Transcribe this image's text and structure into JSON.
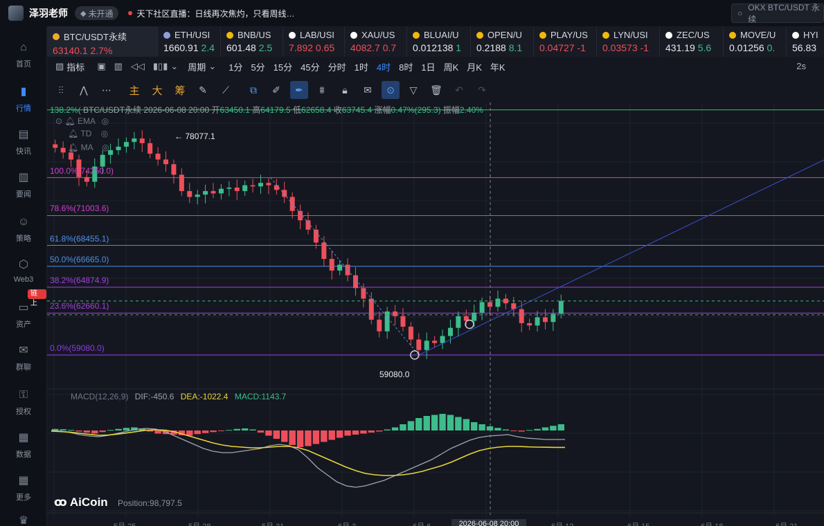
{
  "topbar": {
    "user_name": "泽羽老师",
    "member_status": "未开通",
    "live_text": "天下社区直播：日线再次焦灼，只看周线…",
    "search_placeholder": "OKX BTC/USDT 永续"
  },
  "sidebar": {
    "items": [
      {
        "label": "首页",
        "icon": "home-icon"
      },
      {
        "label": "行情",
        "icon": "market-icon",
        "active": true
      },
      {
        "label": "快讯",
        "icon": "news-icon"
      },
      {
        "label": "要闻",
        "icon": "headline-icon"
      },
      {
        "label": "策略",
        "icon": "robot-icon"
      },
      {
        "label": "Web3",
        "icon": "web3-icon"
      },
      {
        "label": "资产",
        "icon": "wallet-icon"
      },
      {
        "label": "群聊",
        "icon": "chat-icon"
      },
      {
        "label": "授权",
        "icon": "key-icon"
      },
      {
        "label": "数据",
        "icon": "data-icon"
      },
      {
        "label": "更多",
        "icon": "grid-icon"
      },
      {
        "label": "VIP",
        "icon": "vip-icon"
      }
    ],
    "chain_badge": "链上"
  },
  "tickers": [
    {
      "name": "BTC/USDT永续",
      "price": "63140.1",
      "change": "2.7%",
      "dir": "down",
      "color": "#f0a92b",
      "active": true
    },
    {
      "name": "ETH/USI",
      "price": "1660.91",
      "change": "2.4",
      "dir": "up",
      "color": "#8f9fd8"
    },
    {
      "name": "BNB/US",
      "price": "601.48",
      "change": "2.5",
      "dir": "up",
      "color": "#f0b90b"
    },
    {
      "name": "LAB/USI",
      "price": "7.892",
      "change": "0.65",
      "dir": "down",
      "color": "#ffffff"
    },
    {
      "name": "XAU/US",
      "price": "4082.7",
      "change": "0.7",
      "dir": "down",
      "color": "#ffffff"
    },
    {
      "name": "BLUAI/U",
      "price": "0.012138",
      "change": "1",
      "dir": "up",
      "color": "#f0b90b"
    },
    {
      "name": "OPEN/U",
      "price": "0.2188",
      "change": "8.1",
      "dir": "up",
      "color": "#f0b90b"
    },
    {
      "name": "PLAY/US",
      "price": "0.04727",
      "change": "-1",
      "dir": "down",
      "color": "#f0b90b"
    },
    {
      "name": "LYN/USI",
      "price": "0.03573",
      "change": "-1",
      "dir": "down",
      "color": "#f0b90b"
    },
    {
      "name": "ZEC/US",
      "price": "431.19",
      "change": "5.6",
      "dir": "up",
      "color": "#ffffff"
    },
    {
      "name": "MOVE/U",
      "price": "0.01256",
      "change": "0.",
      "dir": "up",
      "color": "#f0b90b"
    },
    {
      "name": "HYI",
      "price": "56.83",
      "change": "",
      "dir": "up",
      "color": "#ffffff"
    }
  ],
  "toolbar": {
    "indicator": "指标",
    "period": "周期",
    "timeframes": [
      "1分",
      "5分",
      "15分",
      "45分",
      "分时",
      "1时",
      "4时",
      "8时",
      "1日",
      "周K",
      "月K",
      "年K"
    ],
    "selected": "4时",
    "refresh": "2s"
  },
  "drawbar": {
    "main": "主",
    "big": "大",
    "chip": "筹"
  },
  "chart": {
    "info": {
      "symbol": "BTC/USDT永续",
      "date": "2026-06-08 20:00",
      "open_label": "开",
      "open": "63450.1",
      "high_label": "高",
      "high": "64179.5",
      "low_label": "低",
      "low": "62658.4",
      "close_label": "收",
      "close": "63745.4",
      "change_label": "涨幅",
      "change": "0.47%(295.3)",
      "amp_label": "振幅",
      "amp": "2.40%"
    },
    "indicators": [
      "EMA",
      "TD",
      "MA"
    ],
    "high_marker": "78077.1",
    "low_marker": "59080.0",
    "fib_top": "138.2%(",
    "fib_levels": [
      {
        "label": "100.0%(74250.0)",
        "color": "#d03fd0"
      },
      {
        "label": "78.6%(71003.6)",
        "color": "#d03fd0"
      },
      {
        "label": "61.8%(68455.1)",
        "color": "#4f8ee6"
      },
      {
        "label": "50.0%(66665.0)",
        "color": "#4f8ee6"
      },
      {
        "label": "38.2%(64874.9)",
        "color": "#a63fe0"
      },
      {
        "label": "23.6%(62660.1)",
        "color": "#a63fe0"
      },
      {
        "label": "0.0%(59080.0)",
        "color": "#8a3fe0"
      }
    ],
    "macd": {
      "name": "MACD(12,26,9)",
      "dif": "DIF:-450.6",
      "dea": "DEA:-1022.4",
      "macd": "MACD:1143.7"
    },
    "watermark": "AiCoin",
    "position": "Position:98,797.5",
    "x_labels": [
      "5月 25",
      "5月 28",
      "5月 31",
      "6月 3",
      "6月 6",
      "6月 12",
      "6月 15",
      "6月 18",
      "6月 21"
    ],
    "crosshair_date": "2026-06-08 20:00"
  },
  "chart_data": {
    "type": "candlestick",
    "title": "BTC/USDT永续",
    "interval": "4时",
    "price_range": [
      57000,
      79500
    ],
    "x": [
      "5月 25",
      "5月 28",
      "5月 31",
      "6月 3",
      "6月 6",
      "6月 12",
      "6月 15",
      "6月 18",
      "6月 21"
    ],
    "close": [
      76800,
      76400,
      75800,
      74300,
      73900,
      75200,
      76200,
      76600,
      76900,
      77300,
      77600,
      77200,
      76300,
      75800,
      75400,
      74500,
      73100,
      72600,
      72800,
      73100,
      72900,
      73300,
      73400,
      73100,
      73600,
      73500,
      73800,
      73600,
      73200,
      72600,
      71400,
      70600,
      69800,
      68700,
      67300,
      66300,
      66800,
      65900,
      64800,
      63900,
      62100,
      61100,
      62800,
      62400,
      61500,
      60400,
      59500,
      60300,
      60100,
      60700,
      61400,
      62400,
      62000,
      62700,
      63600,
      63200,
      63900,
      63500,
      63000,
      61800,
      61600,
      62300,
      61900,
      62600,
      63700
    ],
    "fib_high": 74250.0,
    "fib_low": 59080.0,
    "high_marker": 78077.1,
    "low_marker": 59080.0,
    "macd_hist": [
      150,
      120,
      60,
      -100,
      -200,
      -300,
      -150,
      50,
      150,
      250,
      300,
      200,
      -100,
      -300,
      -350,
      -400,
      -450,
      -500,
      -350,
      -250,
      -150,
      -50,
      50,
      150,
      200,
      100,
      -200,
      -500,
      -800,
      -1100,
      -1400,
      -1600,
      -1500,
      -1300,
      -1100,
      -900,
      -700,
      -500,
      -400,
      -300,
      -200,
      -100,
      100,
      300,
      600,
      900,
      1200,
      1400,
      1500,
      1600,
      1500,
      1300,
      1100,
      800,
      600,
      400,
      250,
      100,
      -50,
      -100,
      50,
      150,
      300,
      450,
      600
    ],
    "dif": [
      200,
      150,
      50,
      -100,
      -200,
      -250,
      -150,
      0,
      150,
      300,
      350,
      300,
      100,
      -200,
      -500,
      -800,
      -1100,
      -1300,
      -1400,
      -1400,
      -1300,
      -1200,
      -1100,
      -900,
      -800,
      -900,
      -1200,
      -1800,
      -2500,
      -3000,
      -3500,
      -3800,
      -3900,
      -3800,
      -3600,
      -3400,
      -3100,
      -2800,
      -2500,
      -2200,
      -1900,
      -1500,
      -1100,
      -800,
      -500,
      -300,
      -200,
      -150,
      -100,
      -250,
      -350,
      -400,
      -450,
      -450,
      -450
    ],
    "dea": [
      150,
      120,
      80,
      0,
      -80,
      -150,
      -130,
      -60,
      30,
      130,
      220,
      250,
      220,
      100,
      -100,
      -300,
      -500,
      -700,
      -850,
      -950,
      -1000,
      -1050,
      -1050,
      -1000,
      -950,
      -950,
      -1050,
      -1250,
      -1550,
      -1850,
      -2150,
      -2450,
      -2700,
      -2900,
      -3000,
      -3050,
      -3050,
      -3000,
      -2900,
      -2750,
      -2550,
      -2350,
      -2100,
      -1800,
      -1500,
      -1250,
      -1100,
      -1000,
      -950,
      -950,
      -980,
      -1000,
      -1010,
      -1020,
      -1022
    ]
  }
}
